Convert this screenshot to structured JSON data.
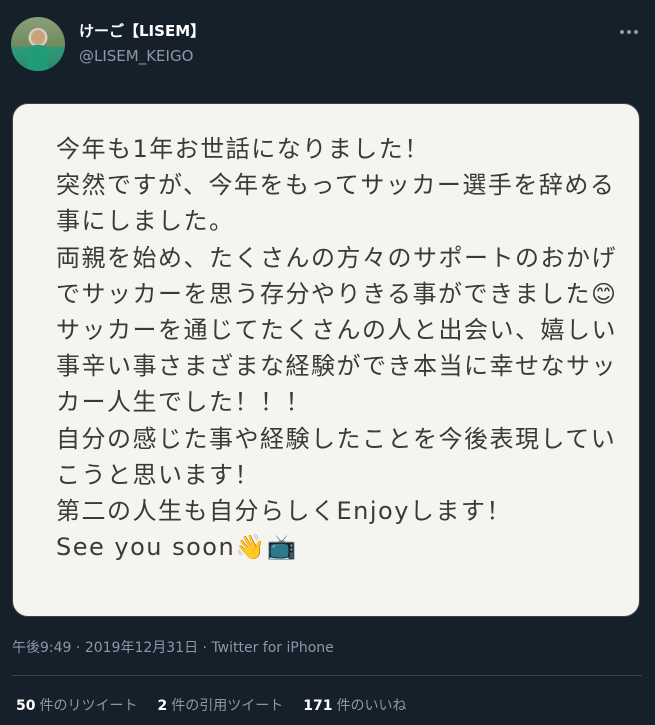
{
  "author": {
    "display_name": "けーご【LISEM】",
    "handle": "@LISEM_KEIGO"
  },
  "tweet_image": {
    "lines": [
      "今年も1年お世話になりました！",
      "突然ですが、今年をもってサッカー選手を辞める",
      "事にしました。",
      "両親を始め、たくさんの方々のサポートのおかげ",
      "でサッカーを思う存分やりきる事ができました😊",
      "サッカーを通じてたくさんの人と出会い、嬉しい",
      "事辛い事さまざまな経験ができ本当に幸せなサッ",
      "カー人生でした！！！",
      "自分の感じた事や経験したことを今後表現してい",
      "こうと思います！",
      "第二の人生も自分らしくEnjoyします！",
      "See you soon👋📺"
    ]
  },
  "meta": {
    "time": "午後9:49",
    "sep1": " · ",
    "date": "2019年12月31日",
    "sep2": " · ",
    "source": "Twitter for iPhone"
  },
  "stats": {
    "retweets_count": "50",
    "retweets_label": "件のリツイート",
    "quotes_count": "2",
    "quotes_label": "件の引用ツイート",
    "likes_count": "171",
    "likes_label": "件のいいね"
  },
  "icons": {
    "more": "more-horizontal-icon"
  }
}
